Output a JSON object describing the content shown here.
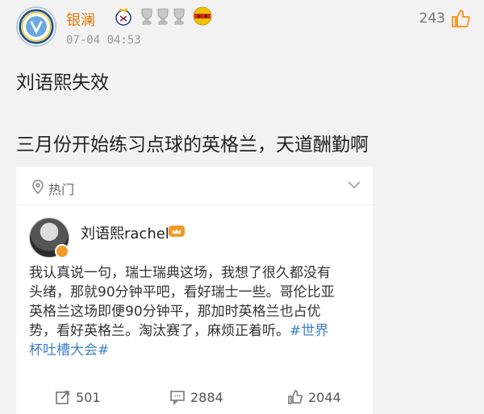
{
  "post": {
    "username": "银澜",
    "timestamp": "07-04 04:53",
    "like_count": "243",
    "text_line1": "刘语熙失效",
    "text_line2": "三月份开始练习点球的英格兰，天道酬勤啊"
  },
  "repost": {
    "section_label": "热门",
    "author": "刘语熙rachel",
    "body_lines": [
      "我认真说一句，瑞士瑞典这场，我想了很久都没有",
      "头绪，那就90分钟平吧，看好瑞士一些。哥伦比亚",
      "英格兰这场即便90分钟平，那加时英格兰也占优",
      "势，看好英格兰。淘汰赛了，麻烦正着听。"
    ],
    "hashtag_part1": "#世界",
    "hashtag_part2": "杯吐槽大会#",
    "repost_count": "501",
    "comment_count": "2884",
    "like_count": "2044"
  },
  "colors": {
    "username": "#d9780e",
    "hashtag": "#3e82c9",
    "background": "#f2f2f2"
  },
  "icons": [
    "club-crest-icon",
    "real-madrid-crest-icon",
    "trophy-icon",
    "spain-emoji-icon",
    "thumbs-up-icon",
    "hot-pin-icon",
    "chevron-down-icon",
    "repost-icon",
    "comment-icon"
  ]
}
